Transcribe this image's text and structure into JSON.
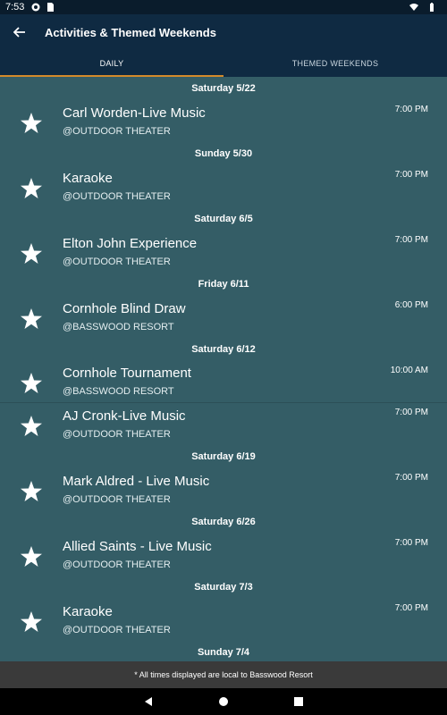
{
  "status_bar": {
    "time": "7:53"
  },
  "app_bar": {
    "title": "Activities & Themed Weekends"
  },
  "tabs": [
    {
      "label": "DAILY",
      "active": true
    },
    {
      "label": "THEMED WEEKENDS",
      "active": false
    }
  ],
  "groups": [
    {
      "date": "Saturday 5/22",
      "events": [
        {
          "name": "Carl Worden-Live Music",
          "venue": "@OUTDOOR THEATER",
          "time": "7:00 PM"
        }
      ]
    },
    {
      "date": "Sunday 5/30",
      "events": [
        {
          "name": "Karaoke",
          "venue": "@OUTDOOR THEATER",
          "time": "7:00 PM"
        }
      ]
    },
    {
      "date": "Saturday 6/5",
      "events": [
        {
          "name": "Elton John Experience",
          "venue": "@OUTDOOR THEATER",
          "time": "7:00 PM"
        }
      ]
    },
    {
      "date": "Friday 6/11",
      "events": [
        {
          "name": "Cornhole Blind Draw",
          "venue": "@BASSWOOD RESORT",
          "time": "6:00 PM"
        }
      ]
    },
    {
      "date": "Saturday 6/12",
      "events": [
        {
          "name": "Cornhole Tournament",
          "venue": "@BASSWOOD RESORT",
          "time": "10:00 AM"
        },
        {
          "name": "AJ Cronk-Live Music",
          "venue": "@OUTDOOR THEATER",
          "time": "7:00 PM"
        }
      ]
    },
    {
      "date": "Saturday 6/19",
      "events": [
        {
          "name": "Mark Aldred - Live Music",
          "venue": "@OUTDOOR THEATER",
          "time": "7:00 PM"
        }
      ]
    },
    {
      "date": "Saturday 6/26",
      "events": [
        {
          "name": "Allied Saints - Live Music",
          "venue": "@OUTDOOR THEATER",
          "time": "7:00 PM"
        }
      ]
    },
    {
      "date": "Saturday 7/3",
      "events": [
        {
          "name": "Karaoke",
          "venue": "@OUTDOOR THEATER",
          "time": "7:00 PM"
        }
      ]
    },
    {
      "date": "Sunday 7/4",
      "events": []
    }
  ],
  "footer": {
    "note": "* All times displayed are local to Basswood Resort"
  },
  "colors": {
    "appbar": "#0f2a42",
    "content": "#345d66",
    "tab_indicator": "#d48a2a",
    "footer": "#3a3a3a"
  },
  "icons": {
    "back": "arrow-left-icon",
    "favorite": "star-icon"
  }
}
